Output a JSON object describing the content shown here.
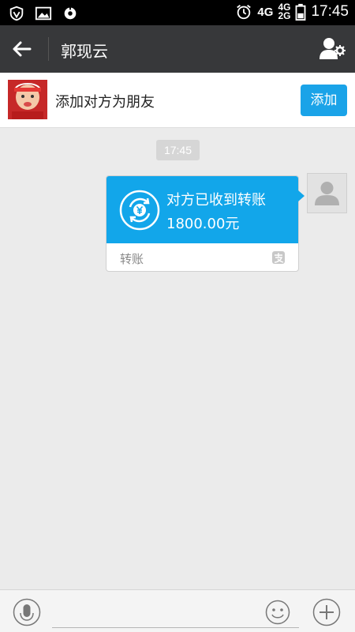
{
  "status_bar": {
    "network_primary": "4G",
    "network_secondary_top": "4G",
    "network_secondary_bottom": "2G",
    "time": "17:45"
  },
  "header": {
    "title": "郭现云"
  },
  "friend_bar": {
    "label": "添加对方为朋友",
    "add_button": "添加"
  },
  "chat": {
    "timestamp": "17:45",
    "transfer": {
      "title": "对方已收到转账",
      "amount": "1800.00元",
      "footer_label": "转账"
    }
  },
  "input": {
    "placeholder": "",
    "value": ""
  },
  "colors": {
    "accent": "#1aa3e8",
    "header_bg": "#37383a",
    "transfer_bg": "#12a6ea",
    "chat_bg": "#ebebeb"
  },
  "icons": {
    "status_left": [
      "shield-icon",
      "image-icon",
      "sync-icon"
    ],
    "status_right": [
      "alarm-icon",
      "battery-icon"
    ],
    "header": [
      "back-arrow-icon",
      "contact-settings-icon"
    ],
    "transfer": [
      "transfer-yuan-icon",
      "alipay-icon"
    ],
    "input": [
      "microphone-icon",
      "emoji-icon",
      "plus-icon"
    ]
  }
}
